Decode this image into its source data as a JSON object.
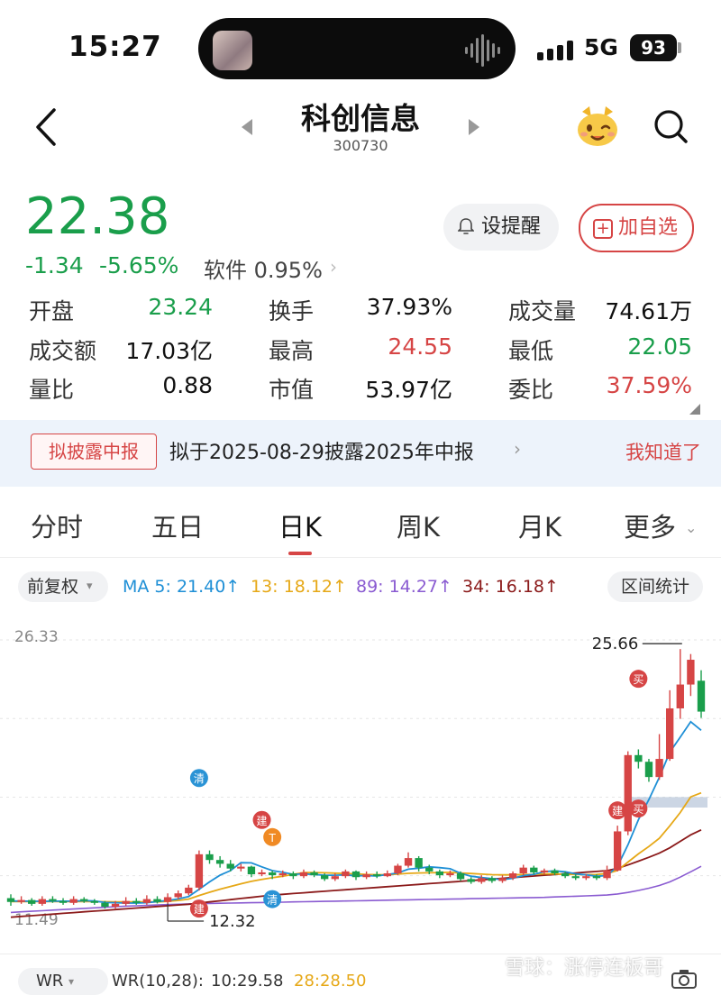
{
  "status_bar": {
    "time": "15:27",
    "network": "5G",
    "battery": "93"
  },
  "header": {
    "title": "科创信息",
    "code": "300730"
  },
  "quote": {
    "price": "22.38",
    "change": "-1.34",
    "change_pct": "-5.65%",
    "sector": "软件 0.95%",
    "alert_label": "设提醒",
    "watchlist_label": "加自选"
  },
  "stats": [
    {
      "label": "开盘",
      "value": "23.24",
      "color": "green"
    },
    {
      "label": "换手",
      "value": "37.93%",
      "color": "black"
    },
    {
      "label": "成交量",
      "value": "74.61万",
      "color": "black"
    },
    {
      "label": "成交额",
      "value": "17.03亿",
      "color": "black"
    },
    {
      "label": "最高",
      "value": "24.55",
      "color": "red"
    },
    {
      "label": "最低",
      "value": "22.05",
      "color": "green"
    },
    {
      "label": "量比",
      "value": "0.88",
      "color": "black"
    },
    {
      "label": "市值",
      "value": "53.97亿",
      "color": "black"
    },
    {
      "label": "委比",
      "value": "37.59%",
      "color": "red"
    }
  ],
  "notice": {
    "tag": "拟披露中报",
    "text": "拟于2025-08-29披露2025年中报",
    "dismiss": "我知道了"
  },
  "tabs": [
    "分时",
    "五日",
    "日K",
    "周K",
    "月K",
    "更多"
  ],
  "active_tab": "日K",
  "indicators": {
    "adjust": "前复权",
    "ma5": "MA 5: 21.40↑",
    "ma13": "13: 18.12↑",
    "ma89": "89: 14.27↑",
    "ma34": "34: 16.18↑",
    "range_stats": "区间统计"
  },
  "colors": {
    "up": "#d64545",
    "down": "#1a9e4b",
    "ma5": "#1e8fd6",
    "ma13": "#e6a817",
    "ma89": "#8a5bd1",
    "ma34": "#8b1a1a"
  },
  "chart_data": {
    "type": "candlestick",
    "y_axis_labels": {
      "top": "26.33",
      "bottom": "11.49"
    },
    "annotations": {
      "high": "25.66",
      "low": "12.32"
    },
    "markers": [
      "清",
      "建",
      "T",
      "清",
      "建",
      "买",
      "建",
      "买"
    ],
    "candles": [
      [
        12.6,
        12.4,
        12.8,
        12.2
      ],
      [
        12.4,
        12.5,
        12.7,
        12.3
      ],
      [
        12.5,
        12.3,
        12.6,
        12.2
      ],
      [
        12.3,
        12.55,
        12.7,
        12.2
      ],
      [
        12.55,
        12.45,
        12.7,
        12.35
      ],
      [
        12.45,
        12.35,
        12.6,
        12.25
      ],
      [
        12.35,
        12.55,
        12.7,
        12.25
      ],
      [
        12.55,
        12.45,
        12.65,
        12.35
      ],
      [
        12.45,
        12.35,
        12.55,
        12.25
      ],
      [
        12.35,
        12.15,
        12.45,
        12.05
      ],
      [
        12.15,
        12.3,
        12.45,
        12.05
      ],
      [
        12.3,
        12.45,
        12.65,
        12.2
      ],
      [
        12.45,
        12.35,
        12.6,
        12.25
      ],
      [
        12.35,
        12.55,
        12.75,
        12.25
      ],
      [
        12.55,
        12.4,
        12.7,
        12.32
      ],
      [
        12.4,
        12.65,
        12.85,
        12.32
      ],
      [
        12.65,
        12.85,
        13.0,
        12.55
      ],
      [
        12.85,
        13.15,
        13.3,
        12.75
      ],
      [
        13.15,
        14.9,
        15.1,
        13.0
      ],
      [
        14.9,
        14.6,
        15.1,
        14.4
      ],
      [
        14.6,
        14.4,
        14.8,
        14.2
      ],
      [
        14.4,
        14.15,
        14.6,
        14.0
      ],
      [
        14.15,
        14.25,
        14.4,
        14.0
      ],
      [
        14.25,
        13.85,
        14.3,
        13.7
      ],
      [
        13.85,
        13.95,
        14.1,
        13.75
      ],
      [
        13.95,
        13.8,
        14.05,
        13.6
      ],
      [
        13.8,
        13.9,
        14.05,
        13.7
      ],
      [
        13.9,
        13.75,
        14.0,
        13.6
      ],
      [
        13.75,
        13.95,
        14.1,
        13.65
      ],
      [
        13.95,
        13.8,
        14.05,
        13.7
      ],
      [
        13.8,
        13.6,
        13.9,
        13.5
      ],
      [
        13.6,
        13.75,
        13.9,
        13.5
      ],
      [
        13.75,
        14.0,
        14.1,
        13.65
      ],
      [
        14.0,
        13.7,
        14.05,
        13.55
      ],
      [
        13.7,
        13.85,
        14.0,
        13.6
      ],
      [
        13.85,
        13.75,
        14.0,
        13.65
      ],
      [
        13.75,
        13.9,
        14.05,
        13.7
      ],
      [
        13.9,
        14.3,
        14.4,
        13.8
      ],
      [
        14.3,
        14.7,
        15.0,
        14.2
      ],
      [
        14.7,
        14.2,
        14.8,
        14.0
      ],
      [
        14.2,
        14.0,
        14.35,
        13.85
      ],
      [
        14.0,
        13.8,
        14.1,
        13.65
      ],
      [
        13.8,
        13.9,
        14.05,
        13.7
      ],
      [
        13.9,
        13.6,
        14.0,
        13.5
      ],
      [
        13.6,
        13.45,
        13.7,
        13.35
      ],
      [
        13.45,
        13.65,
        13.8,
        13.35
      ],
      [
        13.65,
        13.5,
        13.75,
        13.4
      ],
      [
        13.5,
        13.65,
        13.8,
        13.4
      ],
      [
        13.65,
        13.9,
        14.0,
        13.55
      ],
      [
        13.9,
        14.2,
        14.35,
        13.8
      ],
      [
        14.2,
        13.95,
        14.3,
        13.85
      ],
      [
        13.95,
        14.05,
        14.15,
        13.85
      ],
      [
        14.05,
        13.9,
        14.15,
        13.8
      ],
      [
        13.9,
        13.75,
        14.0,
        13.65
      ],
      [
        13.75,
        13.65,
        13.85,
        13.55
      ],
      [
        13.65,
        13.75,
        13.85,
        13.55
      ],
      [
        13.75,
        13.65,
        13.85,
        13.55
      ],
      [
        13.65,
        14.05,
        14.3,
        13.55
      ],
      [
        14.05,
        16.1,
        16.4,
        14.0
      ],
      [
        16.1,
        20.1,
        20.3,
        15.9
      ],
      [
        20.1,
        19.75,
        20.4,
        19.4
      ],
      [
        19.75,
        18.95,
        19.9,
        18.7
      ],
      [
        18.95,
        19.9,
        21.2,
        18.8
      ],
      [
        19.9,
        22.55,
        23.5,
        19.8
      ],
      [
        22.55,
        23.8,
        25.66,
        22.0
      ],
      [
        23.8,
        25.1,
        25.4,
        23.2
      ],
      [
        24.0,
        22.38,
        24.55,
        22.05
      ]
    ],
    "ma5": [
      12.45,
      12.44,
      12.44,
      12.43,
      12.44,
      12.44,
      12.44,
      12.47,
      12.45,
      12.37,
      12.36,
      12.34,
      12.34,
      12.36,
      12.42,
      12.48,
      12.56,
      12.68,
      13.06,
      13.45,
      13.8,
      14.04,
      14.46,
      14.45,
      14.24,
      14.04,
      13.95,
      13.85,
      13.87,
      13.84,
      13.8,
      13.8,
      13.82,
      13.77,
      13.78,
      13.76,
      13.84,
      13.92,
      14.12,
      14.17,
      14.24,
      14.2,
      14.14,
      13.9,
      13.75,
      13.68,
      13.62,
      13.57,
      13.64,
      13.78,
      13.85,
      13.99,
      14.03,
      13.98,
      13.87,
      13.82,
      13.75,
      13.78,
      14.27,
      15.4,
      16.71,
      17.77,
      18.94,
      20.25,
      21.04,
      21.85,
      21.4
    ],
    "ma13": [
      12.42,
      12.42,
      12.42,
      12.42,
      12.42,
      12.42,
      12.42,
      12.42,
      12.42,
      12.41,
      12.4,
      12.4,
      12.4,
      12.4,
      12.4,
      12.43,
      12.48,
      12.55,
      12.74,
      12.91,
      13.07,
      13.21,
      13.35,
      13.48,
      13.58,
      13.67,
      13.75,
      13.85,
      13.94,
      13.94,
      13.93,
      13.91,
      13.89,
      13.87,
      13.84,
      13.83,
      13.83,
      13.86,
      13.9,
      13.92,
      13.93,
      13.94,
      13.95,
      13.92,
      13.89,
      13.86,
      13.83,
      13.82,
      13.82,
      13.84,
      13.85,
      13.87,
      13.87,
      13.85,
      13.84,
      13.83,
      13.84,
      13.89,
      14.05,
      14.49,
      14.92,
      15.31,
      15.74,
      16.39,
      17.09,
      17.91,
      18.12
    ],
    "ma34": [
      11.6,
      11.64,
      11.68,
      11.72,
      11.76,
      11.8,
      11.84,
      11.88,
      11.92,
      11.96,
      12.0,
      12.04,
      12.08,
      12.12,
      12.16,
      12.2,
      12.24,
      12.28,
      12.34,
      12.4,
      12.46,
      12.52,
      12.58,
      12.64,
      12.7,
      12.76,
      12.8,
      12.84,
      12.88,
      12.92,
      12.96,
      13.0,
      13.04,
      13.08,
      13.12,
      13.16,
      13.2,
      13.24,
      13.28,
      13.32,
      13.36,
      13.4,
      13.44,
      13.48,
      13.52,
      13.56,
      13.6,
      13.64,
      13.68,
      13.72,
      13.76,
      13.8,
      13.84,
      13.88,
      13.92,
      13.96,
      14.0,
      14.04,
      14.16,
      14.34,
      14.54,
      14.74,
      14.96,
      15.24,
      15.58,
      15.92,
      16.18
    ],
    "ma89": [
      11.85,
      11.88,
      11.91,
      11.94,
      11.97,
      12.0,
      12.03,
      12.06,
      12.09,
      12.12,
      12.15,
      12.18,
      12.2,
      12.22,
      12.24,
      12.26,
      12.28,
      12.3,
      12.31,
      12.32,
      12.33,
      12.34,
      12.35,
      12.36,
      12.37,
      12.38,
      12.39,
      12.4,
      12.41,
      12.42,
      12.43,
      12.44,
      12.45,
      12.46,
      12.47,
      12.48,
      12.49,
      12.5,
      12.51,
      12.52,
      12.53,
      12.54,
      12.55,
      12.56,
      12.57,
      12.58,
      12.59,
      12.6,
      12.61,
      12.62,
      12.63,
      12.64,
      12.66,
      12.68,
      12.7,
      12.72,
      12.74,
      12.76,
      12.82,
      12.9,
      13.0,
      13.12,
      13.26,
      13.45,
      13.7,
      13.98,
      14.27
    ]
  },
  "sub_indicator": {
    "name": "WR",
    "params": "WR(10,28):",
    "wr10": "10:29.58",
    "wr28": "28:28.50"
  },
  "watermark": "雪球：涨停连板哥"
}
